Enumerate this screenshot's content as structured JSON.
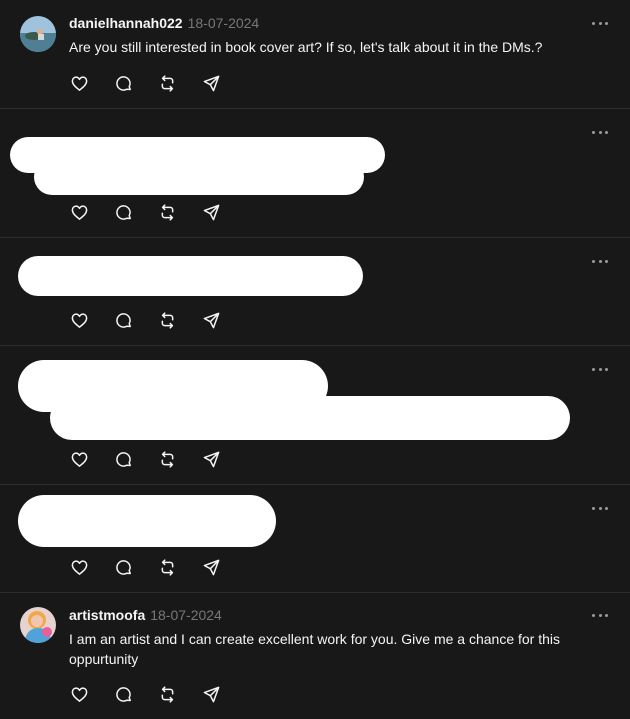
{
  "posts": [
    {
      "username": "danielhannah022",
      "date": "18-07-2024",
      "text": "Are you still interested in book cover art? If so, let's talk about it in the DMs.?",
      "redacted": false
    },
    {
      "redacted": true
    },
    {
      "redacted": true
    },
    {
      "redacted": true
    },
    {
      "redacted": true
    },
    {
      "username": "artistmoofa",
      "date": "18-07-2024",
      "text": "I am an artist and I can create excellent work for you. Give me a chance for this oppurtunity",
      "redacted": false
    }
  ],
  "icons": {
    "like": "heart-icon",
    "reply": "comment-icon",
    "repost": "repost-icon",
    "share": "send-icon",
    "more": "more-icon"
  },
  "colors": {
    "background": "#181818",
    "text": "#f3f5f7",
    "muted": "#777777",
    "divider": "#2e2e2e",
    "redaction": "#ffffff"
  }
}
